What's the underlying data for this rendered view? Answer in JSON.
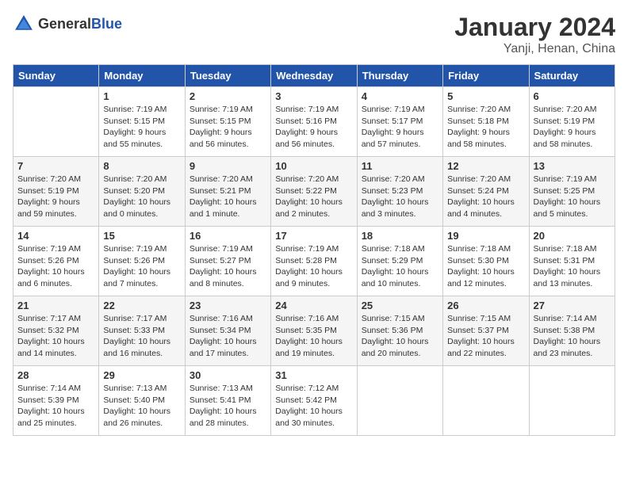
{
  "header": {
    "logo_general": "General",
    "logo_blue": "Blue",
    "month": "January 2024",
    "location": "Yanji, Henan, China"
  },
  "days_of_week": [
    "Sunday",
    "Monday",
    "Tuesday",
    "Wednesday",
    "Thursday",
    "Friday",
    "Saturday"
  ],
  "weeks": [
    [
      {
        "day": "",
        "sunrise": "",
        "sunset": "",
        "daylight": ""
      },
      {
        "day": "1",
        "sunrise": "Sunrise: 7:19 AM",
        "sunset": "Sunset: 5:15 PM",
        "daylight": "Daylight: 9 hours and 55 minutes."
      },
      {
        "day": "2",
        "sunrise": "Sunrise: 7:19 AM",
        "sunset": "Sunset: 5:15 PM",
        "daylight": "Daylight: 9 hours and 56 minutes."
      },
      {
        "day": "3",
        "sunrise": "Sunrise: 7:19 AM",
        "sunset": "Sunset: 5:16 PM",
        "daylight": "Daylight: 9 hours and 56 minutes."
      },
      {
        "day": "4",
        "sunrise": "Sunrise: 7:19 AM",
        "sunset": "Sunset: 5:17 PM",
        "daylight": "Daylight: 9 hours and 57 minutes."
      },
      {
        "day": "5",
        "sunrise": "Sunrise: 7:20 AM",
        "sunset": "Sunset: 5:18 PM",
        "daylight": "Daylight: 9 hours and 58 minutes."
      },
      {
        "day": "6",
        "sunrise": "Sunrise: 7:20 AM",
        "sunset": "Sunset: 5:19 PM",
        "daylight": "Daylight: 9 hours and 58 minutes."
      }
    ],
    [
      {
        "day": "7",
        "sunrise": "Sunrise: 7:20 AM",
        "sunset": "Sunset: 5:19 PM",
        "daylight": "Daylight: 9 hours and 59 minutes."
      },
      {
        "day": "8",
        "sunrise": "Sunrise: 7:20 AM",
        "sunset": "Sunset: 5:20 PM",
        "daylight": "Daylight: 10 hours and 0 minutes."
      },
      {
        "day": "9",
        "sunrise": "Sunrise: 7:20 AM",
        "sunset": "Sunset: 5:21 PM",
        "daylight": "Daylight: 10 hours and 1 minute."
      },
      {
        "day": "10",
        "sunrise": "Sunrise: 7:20 AM",
        "sunset": "Sunset: 5:22 PM",
        "daylight": "Daylight: 10 hours and 2 minutes."
      },
      {
        "day": "11",
        "sunrise": "Sunrise: 7:20 AM",
        "sunset": "Sunset: 5:23 PM",
        "daylight": "Daylight: 10 hours and 3 minutes."
      },
      {
        "day": "12",
        "sunrise": "Sunrise: 7:20 AM",
        "sunset": "Sunset: 5:24 PM",
        "daylight": "Daylight: 10 hours and 4 minutes."
      },
      {
        "day": "13",
        "sunrise": "Sunrise: 7:19 AM",
        "sunset": "Sunset: 5:25 PM",
        "daylight": "Daylight: 10 hours and 5 minutes."
      }
    ],
    [
      {
        "day": "14",
        "sunrise": "Sunrise: 7:19 AM",
        "sunset": "Sunset: 5:26 PM",
        "daylight": "Daylight: 10 hours and 6 minutes."
      },
      {
        "day": "15",
        "sunrise": "Sunrise: 7:19 AM",
        "sunset": "Sunset: 5:26 PM",
        "daylight": "Daylight: 10 hours and 7 minutes."
      },
      {
        "day": "16",
        "sunrise": "Sunrise: 7:19 AM",
        "sunset": "Sunset: 5:27 PM",
        "daylight": "Daylight: 10 hours and 8 minutes."
      },
      {
        "day": "17",
        "sunrise": "Sunrise: 7:19 AM",
        "sunset": "Sunset: 5:28 PM",
        "daylight": "Daylight: 10 hours and 9 minutes."
      },
      {
        "day": "18",
        "sunrise": "Sunrise: 7:18 AM",
        "sunset": "Sunset: 5:29 PM",
        "daylight": "Daylight: 10 hours and 10 minutes."
      },
      {
        "day": "19",
        "sunrise": "Sunrise: 7:18 AM",
        "sunset": "Sunset: 5:30 PM",
        "daylight": "Daylight: 10 hours and 12 minutes."
      },
      {
        "day": "20",
        "sunrise": "Sunrise: 7:18 AM",
        "sunset": "Sunset: 5:31 PM",
        "daylight": "Daylight: 10 hours and 13 minutes."
      }
    ],
    [
      {
        "day": "21",
        "sunrise": "Sunrise: 7:17 AM",
        "sunset": "Sunset: 5:32 PM",
        "daylight": "Daylight: 10 hours and 14 minutes."
      },
      {
        "day": "22",
        "sunrise": "Sunrise: 7:17 AM",
        "sunset": "Sunset: 5:33 PM",
        "daylight": "Daylight: 10 hours and 16 minutes."
      },
      {
        "day": "23",
        "sunrise": "Sunrise: 7:16 AM",
        "sunset": "Sunset: 5:34 PM",
        "daylight": "Daylight: 10 hours and 17 minutes."
      },
      {
        "day": "24",
        "sunrise": "Sunrise: 7:16 AM",
        "sunset": "Sunset: 5:35 PM",
        "daylight": "Daylight: 10 hours and 19 minutes."
      },
      {
        "day": "25",
        "sunrise": "Sunrise: 7:15 AM",
        "sunset": "Sunset: 5:36 PM",
        "daylight": "Daylight: 10 hours and 20 minutes."
      },
      {
        "day": "26",
        "sunrise": "Sunrise: 7:15 AM",
        "sunset": "Sunset: 5:37 PM",
        "daylight": "Daylight: 10 hours and 22 minutes."
      },
      {
        "day": "27",
        "sunrise": "Sunrise: 7:14 AM",
        "sunset": "Sunset: 5:38 PM",
        "daylight": "Daylight: 10 hours and 23 minutes."
      }
    ],
    [
      {
        "day": "28",
        "sunrise": "Sunrise: 7:14 AM",
        "sunset": "Sunset: 5:39 PM",
        "daylight": "Daylight: 10 hours and 25 minutes."
      },
      {
        "day": "29",
        "sunrise": "Sunrise: 7:13 AM",
        "sunset": "Sunset: 5:40 PM",
        "daylight": "Daylight: 10 hours and 26 minutes."
      },
      {
        "day": "30",
        "sunrise": "Sunrise: 7:13 AM",
        "sunset": "Sunset: 5:41 PM",
        "daylight": "Daylight: 10 hours and 28 minutes."
      },
      {
        "day": "31",
        "sunrise": "Sunrise: 7:12 AM",
        "sunset": "Sunset: 5:42 PM",
        "daylight": "Daylight: 10 hours and 30 minutes."
      },
      {
        "day": "",
        "sunrise": "",
        "sunset": "",
        "daylight": ""
      },
      {
        "day": "",
        "sunrise": "",
        "sunset": "",
        "daylight": ""
      },
      {
        "day": "",
        "sunrise": "",
        "sunset": "",
        "daylight": ""
      }
    ]
  ]
}
